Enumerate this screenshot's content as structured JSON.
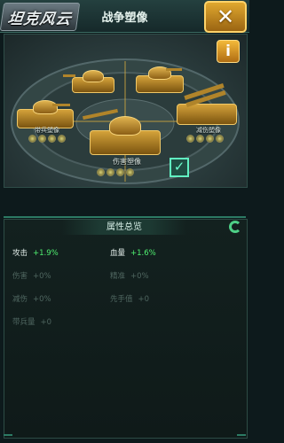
{
  "header": {
    "logo": "坦克风云",
    "title": "战争塑像",
    "close_icon": "close-x-icon"
  },
  "scene": {
    "info_label": "i",
    "statues": [
      {
        "name": "带兵塑像",
        "dots": 4
      },
      {
        "name": "伤害塑像",
        "dots": 4,
        "selected": true
      },
      {
        "name": "减伤塑像",
        "dots": 4
      }
    ],
    "check_mark": "✓"
  },
  "panel": {
    "title": "属性总览",
    "stats": [
      {
        "key": "攻击",
        "value": "+1.9%",
        "active": true
      },
      {
        "key": "血量",
        "value": "+1.6%",
        "active": true
      },
      {
        "key": "伤害",
        "value": "+0%",
        "active": false
      },
      {
        "key": "精准",
        "value": "+0%",
        "active": false
      },
      {
        "key": "减伤",
        "value": "+0%",
        "active": false
      },
      {
        "key": "先手值",
        "value": "+0",
        "active": false
      },
      {
        "key": "带兵量",
        "value": "+0",
        "active": false
      }
    ]
  },
  "colors": {
    "accent": "#4ff070",
    "gold": "#d4a23a",
    "frame": "#2c7a64"
  }
}
